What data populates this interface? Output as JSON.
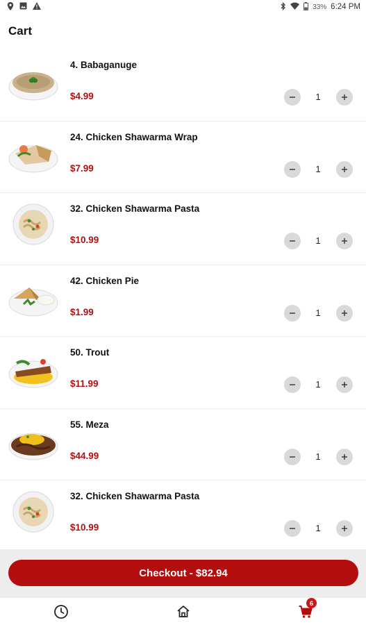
{
  "status_bar": {
    "battery_pct": "33%",
    "time": "6:24 PM"
  },
  "page": {
    "title": "Cart"
  },
  "cart": {
    "items": [
      {
        "name": "4. Babaganuge",
        "price": "$4.99",
        "qty": "1",
        "thumb": "plate-babaganuge"
      },
      {
        "name": "24. Chicken Shawarma Wrap",
        "price": "$7.99",
        "qty": "1",
        "thumb": "plate-wrap"
      },
      {
        "name": "32. Chicken Shawarma Pasta",
        "price": "$10.99",
        "qty": "1",
        "thumb": "plate-pasta"
      },
      {
        "name": "42. Chicken Pie",
        "price": "$1.99",
        "qty": "1",
        "thumb": "plate-pie"
      },
      {
        "name": "50. Trout",
        "price": "$11.99",
        "qty": "1",
        "thumb": "plate-trout"
      },
      {
        "name": "55. Meza",
        "price": "$44.99",
        "qty": "1",
        "thumb": "plate-meza"
      },
      {
        "name": "32. Chicken Shawarma Pasta",
        "price": "$10.99",
        "qty": "1",
        "thumb": "plate-pasta"
      }
    ]
  },
  "checkout": {
    "label": "Checkout - $82.94"
  },
  "nav": {
    "cart_count": "6"
  },
  "colors": {
    "accent": "#b30d0d",
    "price": "#b01010",
    "qty_button": "#d9d9d9"
  },
  "icons": [
    "location-icon",
    "gallery-icon",
    "warning-icon",
    "bluetooth-icon",
    "wifi-icon",
    "battery-icon",
    "minus-icon",
    "plus-icon",
    "history-icon",
    "home-icon",
    "cart-icon"
  ]
}
